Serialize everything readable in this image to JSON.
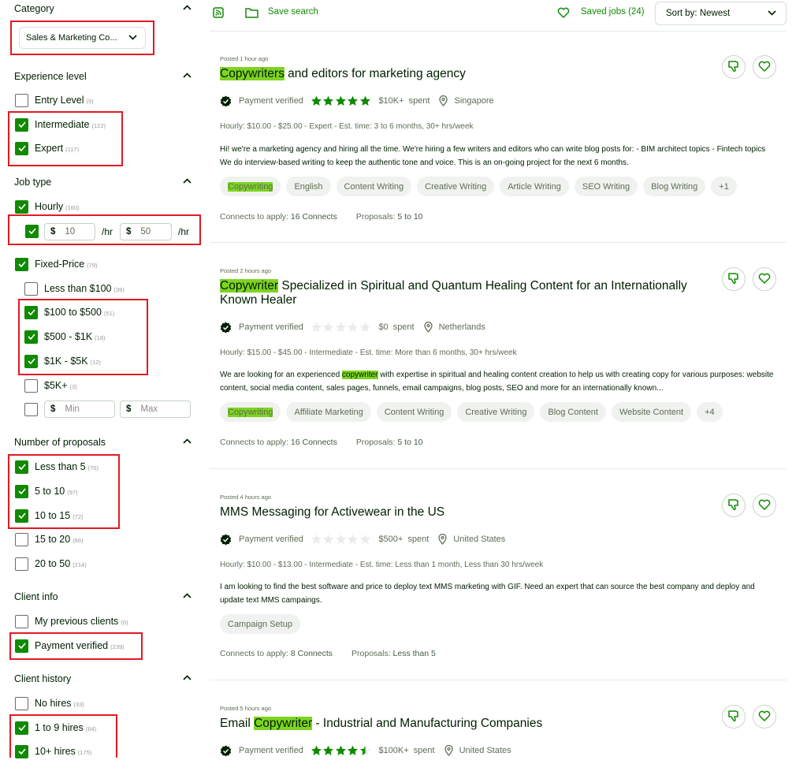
{
  "sidebar": {
    "category": {
      "title": "Category",
      "selected": "Sales & Marketing Co..."
    },
    "experience": {
      "title": "Experience level",
      "items": [
        {
          "label": "Entry Level",
          "count": "(9)",
          "checked": false
        },
        {
          "label": "Intermediate",
          "count": "(122)",
          "checked": true
        },
        {
          "label": "Expert",
          "count": "(117)",
          "checked": true
        }
      ]
    },
    "job_type": {
      "title": "Job type",
      "hourly": {
        "label": "Hourly",
        "count": "(160)",
        "checked": true
      },
      "rate": {
        "checked": true,
        "currency": "$",
        "min": "10",
        "max": "50",
        "unit": "/hr"
      },
      "fixed": {
        "label": "Fixed-Price",
        "count": "(79)",
        "checked": true
      },
      "fixed_items": [
        {
          "label": "Less than $100",
          "count": "(39)",
          "checked": false
        },
        {
          "label": "$100 to $500",
          "count": "(51)",
          "checked": true
        },
        {
          "label": "$500 - $1K",
          "count": "(18)",
          "checked": true
        },
        {
          "label": "$1K - $5K",
          "count": "(12)",
          "checked": true
        },
        {
          "label": "$5K+",
          "count": "(3)",
          "checked": false
        }
      ],
      "custom": {
        "checked": false,
        "currency": "$",
        "min_placeholder": "Min",
        "max_placeholder": "Max"
      }
    },
    "proposals": {
      "title": "Number of proposals",
      "items": [
        {
          "label": "Less than 5",
          "count": "(70)",
          "checked": true
        },
        {
          "label": "5 to 10",
          "count": "(97)",
          "checked": true
        },
        {
          "label": "10 to 15",
          "count": "(72)",
          "checked": true
        },
        {
          "label": "15 to 20",
          "count": "(66)",
          "checked": false
        },
        {
          "label": "20 to 50",
          "count": "(214)",
          "checked": false
        }
      ]
    },
    "client_info": {
      "title": "Client info",
      "items": [
        {
          "label": "My previous clients",
          "count": "(0)",
          "checked": false
        },
        {
          "label": "Payment verified",
          "count": "(239)",
          "checked": true
        }
      ]
    },
    "client_history": {
      "title": "Client history",
      "items": [
        {
          "label": "No hires",
          "count": "(33)",
          "checked": false
        },
        {
          "label": "1 to 9 hires",
          "count": "(64)",
          "checked": true
        },
        {
          "label": "10+ hires",
          "count": "(175)",
          "checked": true
        }
      ]
    }
  },
  "topbar": {
    "save_search": "Save search",
    "saved_jobs": "Saved jobs (24)",
    "sort": "Sort by: Newest"
  },
  "colors": {
    "accent": "#108a00",
    "highlight": "#7ed321",
    "annotation": "#e11a23"
  },
  "jobs": [
    {
      "posted": "Posted 1 hour ago",
      "title_hl": "Copywriters",
      "title_rest": " and editors for marketing agency",
      "verified": "Payment verified",
      "rating": 5,
      "spent_amount": "$10K+",
      "spent_label": "spent",
      "location": "Singapore",
      "budget": "Hourly: $10.00 - $25.00 - Expert - Est. time: 3 to 6 months, 30+ hrs/week",
      "description": "Hi! we're a marketing agency and hiring all the time. We're hiring a few writers and editors who can write blog posts for: - BIM architect topics - Fintech topics We do interview-based writing to keep the authentic tone and voice. This is an on-going project for the next 6 months.",
      "tags": [
        "Copywriting",
        "English",
        "Content Writing",
        "Creative Writing",
        "Article Writing",
        "SEO Writing",
        "Blog Writing",
        "+1"
      ],
      "connects_label": "Connects to apply:",
      "connects": "16 Connects",
      "proposals_label": "Proposals:",
      "proposals": "5 to 10"
    },
    {
      "posted": "Posted 2 hours ago",
      "title_hl": "Copywriter",
      "title_rest": " Specialized in Spiritual and Quantum Healing Content for an Internationally Known Healer",
      "verified": "Payment verified",
      "rating": 0,
      "spent_amount": "$0",
      "spent_label": "spent",
      "location": "Netherlands",
      "budget": "Hourly: $15.00 - $45.00 - Intermediate - Est. time: More than 6 months, 30+ hrs/week",
      "desc_before": "We are looking for an experienced ",
      "desc_hl": "copywriter",
      "desc_after": " with expertise in spiritual and healing content creation to help us with creating copy for various purposes: website content, social media content, sales pages, funnels, email campaigns, blog posts, SEO and more for an internationally known...",
      "tags": [
        "Copywriting",
        "Affiliate Marketing",
        "Content Writing",
        "Creative Writing",
        "Blog Content",
        "Website Content",
        "+4"
      ],
      "connects_label": "Connects to apply:",
      "connects": "16 Connects",
      "proposals_label": "Proposals:",
      "proposals": "5 to 10"
    },
    {
      "posted": "Posted 4 hours ago",
      "title": "MMS Messaging for Activewear in the US",
      "verified": "Payment verified",
      "rating": 0,
      "spent_amount": "$500+",
      "spent_label": "spent",
      "location": "United States",
      "budget": "Hourly: $10.00 - $13.00 - Intermediate - Est. time: Less than 1 month, Less than 30 hrs/week",
      "description": "I am looking to find the best software and price to deploy text MMS marketing with GIF. Need an expert that can source the best company and deploy and update text MMS campaings.",
      "tags": [
        "Campaign Setup"
      ],
      "connects_label": "Connects to apply:",
      "connects": "8 Connects",
      "proposals_label": "Proposals:",
      "proposals": "Less than 5"
    },
    {
      "posted": "Posted 5 hours ago",
      "title_pre": "Email ",
      "title_hl": "Copywriter",
      "title_rest": " - Industrial and Manufacturing Companies",
      "verified": "Payment verified",
      "rating": 4.5,
      "spent_amount": "$100K+",
      "spent_label": "spent",
      "location": "United States"
    }
  ]
}
